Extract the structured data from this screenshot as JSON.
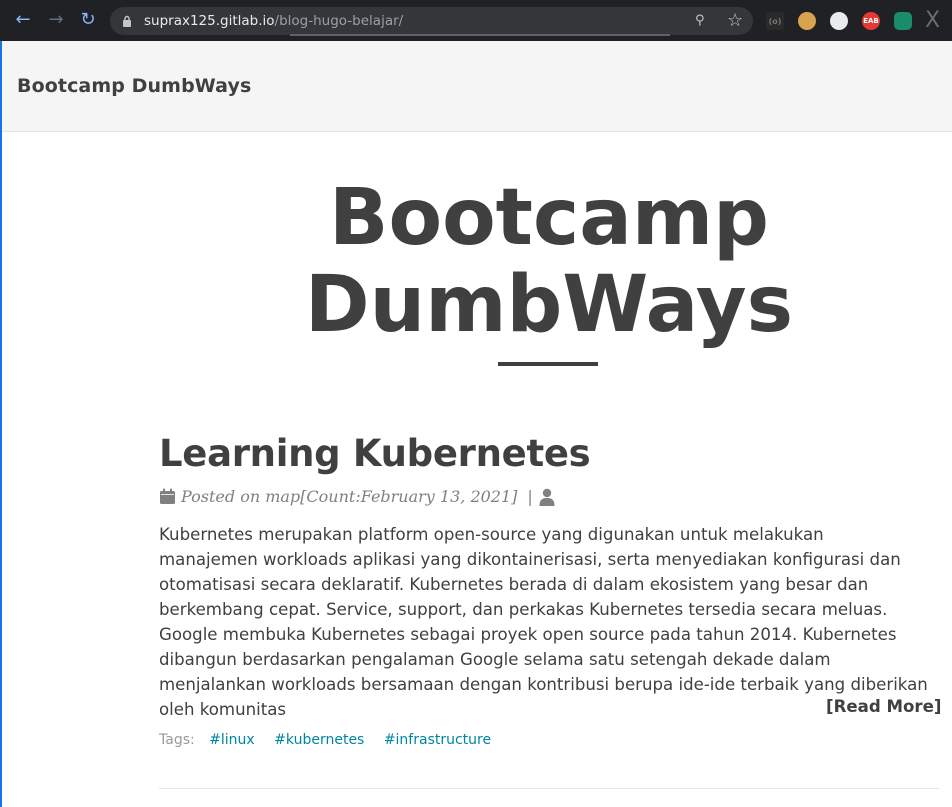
{
  "browser": {
    "url_host": "suprax125.gitlab.io",
    "url_path": "/blog-hugo-belajar/",
    "extensions": [
      {
        "name": "ext-1-icon",
        "text": "(o)"
      },
      {
        "name": "cookie-icon",
        "text": ""
      },
      {
        "name": "ext-3-icon",
        "text": ""
      },
      {
        "name": "ext-4-icon",
        "text": "EAB"
      },
      {
        "name": "ext-5-icon",
        "text": ""
      }
    ]
  },
  "navbar": {
    "brand": "Bootcamp DumbWays"
  },
  "hero": {
    "title_line1": "Bootcamp",
    "title_line2": "DumbWays"
  },
  "post": {
    "title": "Learning Kubernetes",
    "meta": "Posted on map[Count:February 13, 2021]",
    "meta_sep": "|",
    "body_lines": [
      "Kubernetes merupakan platform open-source yang digunakan untuk melakukan",
      "manajemen workloads aplikasi yang dikontainerisasi, serta menyediakan konfigurasi dan",
      "otomatisasi secara deklaratif. Kubernetes berada di dalam ekosistem yang besar dan",
      "berkembang cepat. Service, support, dan perkakas Kubernetes tersedia secara meluas.",
      "Google membuka Kubernetes sebagai proyek open source pada tahun 2014. Kubernetes",
      "dibangun berdasarkan pengalaman Google selama satu setengah dekade dalam",
      "menjalankan workloads bersamaan dengan kontribusi berupa ide-ide terbaik yang diberikan",
      "oleh komunitas"
    ],
    "read_more": "[Read More]",
    "tags_label": "Tags:",
    "tags": [
      "#linux",
      "#kubernetes",
      "#infrastructure"
    ]
  }
}
